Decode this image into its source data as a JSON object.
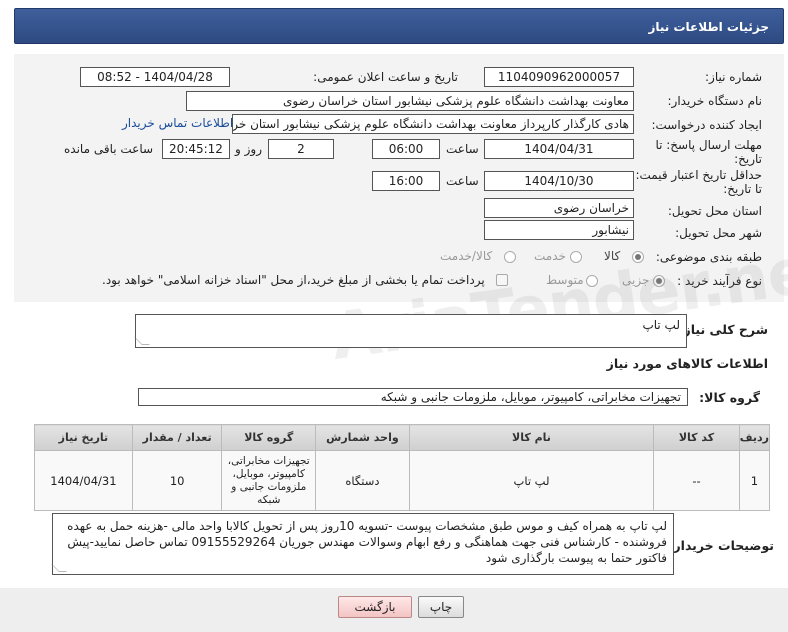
{
  "header": {
    "title": "جزئیات اطلاعات نیاز"
  },
  "form": {
    "need_number": {
      "label": "شماره نیاز:",
      "value": "1104090962000057"
    },
    "announce": {
      "label": "تاریخ و ساعت اعلان عمومی:",
      "value": "1404/04/28 - 08:52"
    },
    "buyer_org": {
      "label": "نام دستگاه خریدار:",
      "value": "معاونت بهداشت دانشگاه علوم پزشکی نیشابور استان خراسان رضوی"
    },
    "requester": {
      "label": "ایجاد کننده درخواست:",
      "value": "هادی کارگذار کارپرداز معاونت بهداشت دانشگاه علوم پزشکی نیشابور استان خر",
      "contact_link": "اطلاعات تماس خریدار"
    },
    "reply_deadline": {
      "label_line1": "مهلت ارسال پاسخ: تا",
      "label_line2": "تاریخ:",
      "date": "1404/04/31",
      "time_label": "ساعت",
      "time": "06:00",
      "days": "2",
      "days_label": "روز و",
      "remaining": "20:45:12",
      "remaining_label": "ساعت باقی مانده"
    },
    "price_validity": {
      "label_line1": "حداقل تاریخ اعتبار قیمت:",
      "label_line2": "تا تاریخ:",
      "date": "1404/10/30",
      "time_label": "ساعت",
      "time": "16:00"
    },
    "delivery_province": {
      "label": "استان محل تحویل:",
      "value": "خراسان رضوی"
    },
    "delivery_city": {
      "label": "شهر محل تحویل:",
      "value": "نیشابور"
    },
    "category": {
      "label": "طبقه بندی موضوعی:",
      "options": [
        "کالا",
        "خدمت",
        "کالا/خدمت"
      ],
      "selected": "کالا"
    },
    "process": {
      "label": "نوع فرآیند خرید :",
      "options": [
        "جزیی",
        "متوسط"
      ],
      "selected": "جزیی",
      "payment_note": "پرداخت تمام یا بخشی از مبلغ خرید،از محل \"اسناد خزانه اسلامی\" خواهد بود."
    }
  },
  "general_desc": {
    "label": "شرح کلی نیاز:",
    "value": "لپ تاپ"
  },
  "goods_info": {
    "title": "اطلاعات کالاهای مورد نیاز"
  },
  "goods_group": {
    "label": "گروه کالا:",
    "value": "تجهیزات مخابراتی، کامپیوتر، موبایل، ملزومات جانبی و شبکه"
  },
  "table": {
    "headers": [
      "ردیف",
      "کد کالا",
      "نام کالا",
      "واحد شمارش",
      "گروه کالا",
      "تعداد / مقدار",
      "تاریخ نیاز"
    ],
    "rows": [
      {
        "row": "1",
        "code": "--",
        "name": "لپ تاپ",
        "unit": "دستگاه",
        "group": "تجهیزات مخابراتی، کامپیوتر، موبایل، ملزومات جانبی و شبکه",
        "qty": "10",
        "date": "1404/04/31"
      }
    ]
  },
  "buyer_notes": {
    "label": "توضیحات خریدار:",
    "value": "لپ تاپ به همراه کیف و موس طبق مشخصات پیوست -تسویه 10روز پس از تحویل کالابا واحد مالی -هزینه حمل به عهده فروشنده - کارشناس فنی جهت هماهنگی و رفع ابهام وسوالات مهندس جوریان 09155529264 تماس حاصل نمایید-پیش فاکتور حتما به پیوست بارگذاری شود"
  },
  "buttons": {
    "print": "چاپ",
    "back": "بازگشت"
  },
  "watermark": "AriaTender.neT"
}
